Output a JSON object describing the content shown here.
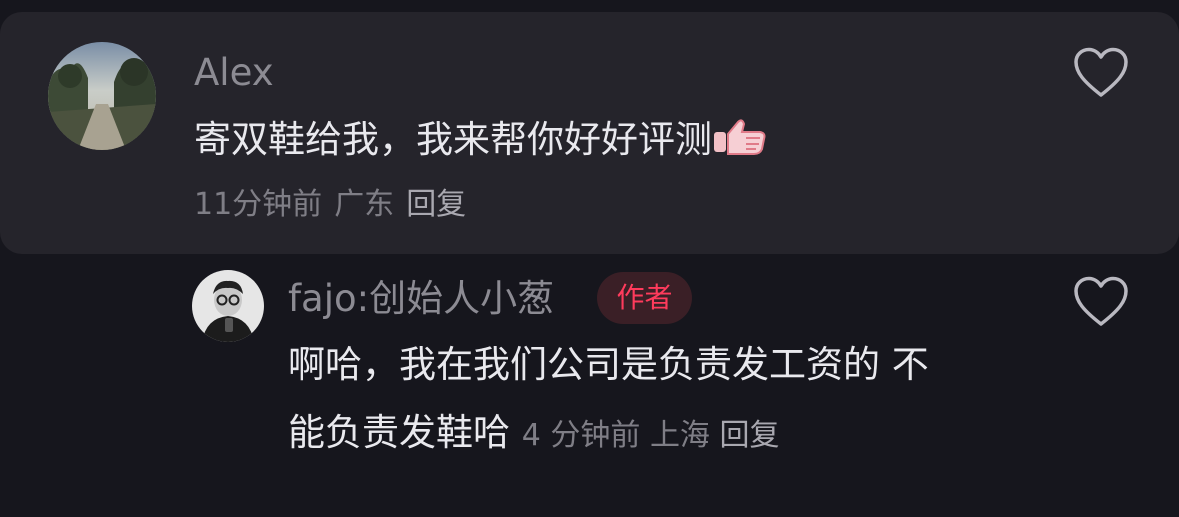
{
  "comment": {
    "username": "Alex",
    "text": "寄双鞋给我，我来帮你好好评测",
    "emoji": "thumbs-up-icon",
    "time": "11分钟前",
    "location": "广东",
    "reply_label": "回复"
  },
  "reply": {
    "username": "fajo:创始人小葱",
    "badge": "作者",
    "text_line1": "啊哈，我在我们公司是负责发工资的 不",
    "text_line2": "能负责发鞋哈",
    "time": "4 分钟前",
    "location": "上海",
    "reply_label": "回复"
  },
  "colors": {
    "background": "#16161d",
    "card": "#25242b",
    "badge_text": "#ff3b5c",
    "badge_bg": "#3a1f26"
  }
}
